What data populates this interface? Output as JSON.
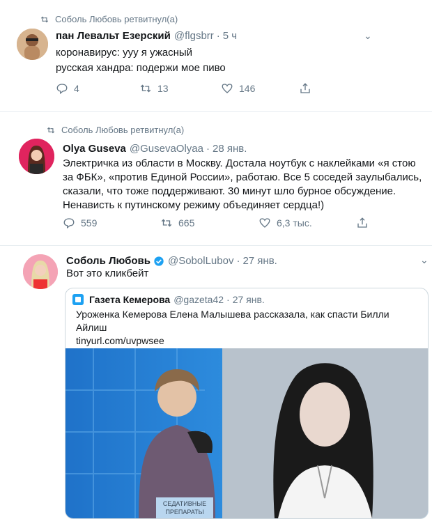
{
  "tweet1": {
    "retweet_label": "Соболь Любовь ретвитнул(а)",
    "name": "пан Левальт Езерский",
    "handle": "@flgsbrr",
    "time": "5 ч",
    "lines": [
      "коронавирус: ууу я ужасный",
      "русская хандра: подержи мое пиво"
    ],
    "replies": "4",
    "retweets": "13",
    "likes": "146"
  },
  "tweet2": {
    "retweet_label": "Соболь Любовь ретвитнул(а)",
    "name": "Olya Guseva",
    "handle": "@GusevaOlyaa",
    "time": "28 янв.",
    "lines": [
      "Электричка из области в Москву. Достала ноутбук с наклейками «я стою",
      "за ФБК», «против Единой России», работаю. Все 5 соседей заулыбались,",
      "сказали, что тоже поддерживают. 30 минут шло бурное обсуждение.",
      "Ненависть к путинскому режиму объединяет сердца!)"
    ],
    "replies": "559",
    "retweets": "665",
    "likes": "6,3 тыс."
  },
  "tweet3": {
    "name": "Соболь Любовь",
    "handle": "@SobolLubov",
    "time": "27 янв.",
    "text": "Вот это кликбейт",
    "quote": {
      "name": "Газета Кемерова",
      "handle": "@gazeta42",
      "time": "27 янв.",
      "lines": [
        "Уроженка Кемерова Елена Малышева рассказала, как спасти Билли",
        "Айлиш"
      ],
      "link": "tinyurl.com/uvpwsee",
      "image_caption": [
        "СЕДАТИВНЫЕ",
        "ПРЕПАРАТЫ"
      ]
    }
  },
  "colors": {
    "accent": "#1da1f2",
    "muted": "#657786",
    "text": "#14171a",
    "border": "#e6ecf0"
  }
}
